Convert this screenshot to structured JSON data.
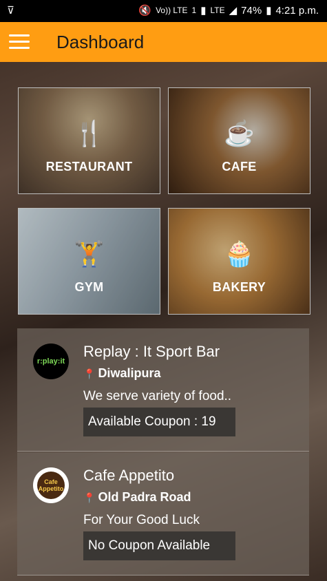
{
  "status_bar": {
    "left_icon": "network-check-icon",
    "signal_labels": [
      "Vo)) LTE",
      "1",
      "LTE"
    ],
    "battery": "74%",
    "time": "4:21 p.m."
  },
  "app_bar": {
    "menu_icon": "hamburger-icon",
    "title": "Dashboard",
    "color": "#ff9d12"
  },
  "categories": [
    {
      "label": "RESTAURANT",
      "icon": "restaurant-icon"
    },
    {
      "label": "CAFE",
      "icon": "coffee-cup-icon"
    },
    {
      "label": "GYM",
      "icon": "weightlifter-icon"
    },
    {
      "label": "BAKERY",
      "icon": "cupcake-icon"
    }
  ],
  "listings": [
    {
      "name": "Replay : It Sport Bar",
      "location": "Diwalipura",
      "description": "We serve variety of food..",
      "coupon": "Available Coupon : 19",
      "logo_text": "replay:it"
    },
    {
      "name": "Cafe Appetito",
      "location": "Old Padra Road",
      "description": "For Your Good Luck",
      "coupon": "No Coupon Available",
      "logo_text": "Cafe Appetito"
    }
  ]
}
